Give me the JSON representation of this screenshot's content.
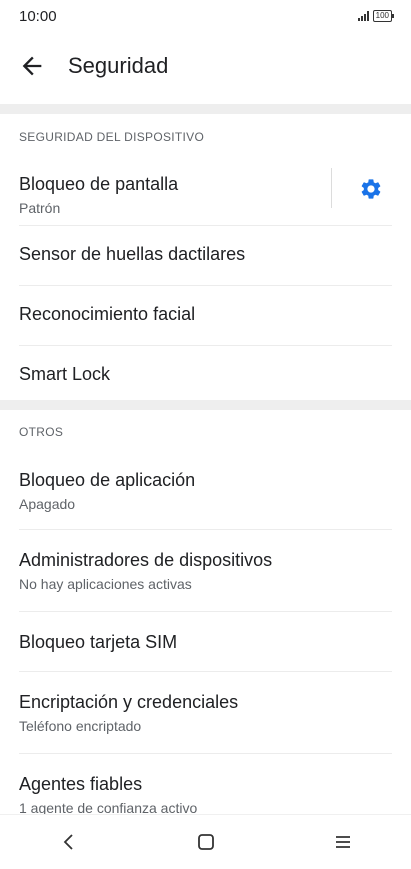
{
  "status": {
    "time": "10:00",
    "battery": "100"
  },
  "header": {
    "title": "Seguridad"
  },
  "sections": [
    {
      "header": "SEGURIDAD DEL DISPOSITIVO",
      "items": [
        {
          "label": "Bloqueo de pantalla",
          "sub": "Patrón",
          "icon": "gear-icon"
        },
        {
          "label": "Sensor de huellas dactilares"
        },
        {
          "label": "Reconocimiento facial"
        },
        {
          "label": "Smart Lock"
        }
      ]
    },
    {
      "header": "OTROS",
      "items": [
        {
          "label": "Bloqueo de aplicación",
          "sub": "Apagado"
        },
        {
          "label": "Administradores de dispositivos",
          "sub": "No hay aplicaciones activas"
        },
        {
          "label": "Bloqueo tarjeta SIM"
        },
        {
          "label": "Encriptación y credenciales",
          "sub": "Teléfono encriptado"
        },
        {
          "label": "Agentes fiables",
          "sub": "1 agente de confianza activo"
        }
      ]
    }
  ],
  "colors": {
    "accent": "#1a73e8",
    "divider": "#eeeeee"
  },
  "navbar": {
    "icons": [
      "back-nav-icon",
      "home-nav-icon",
      "recents-nav-icon"
    ]
  }
}
